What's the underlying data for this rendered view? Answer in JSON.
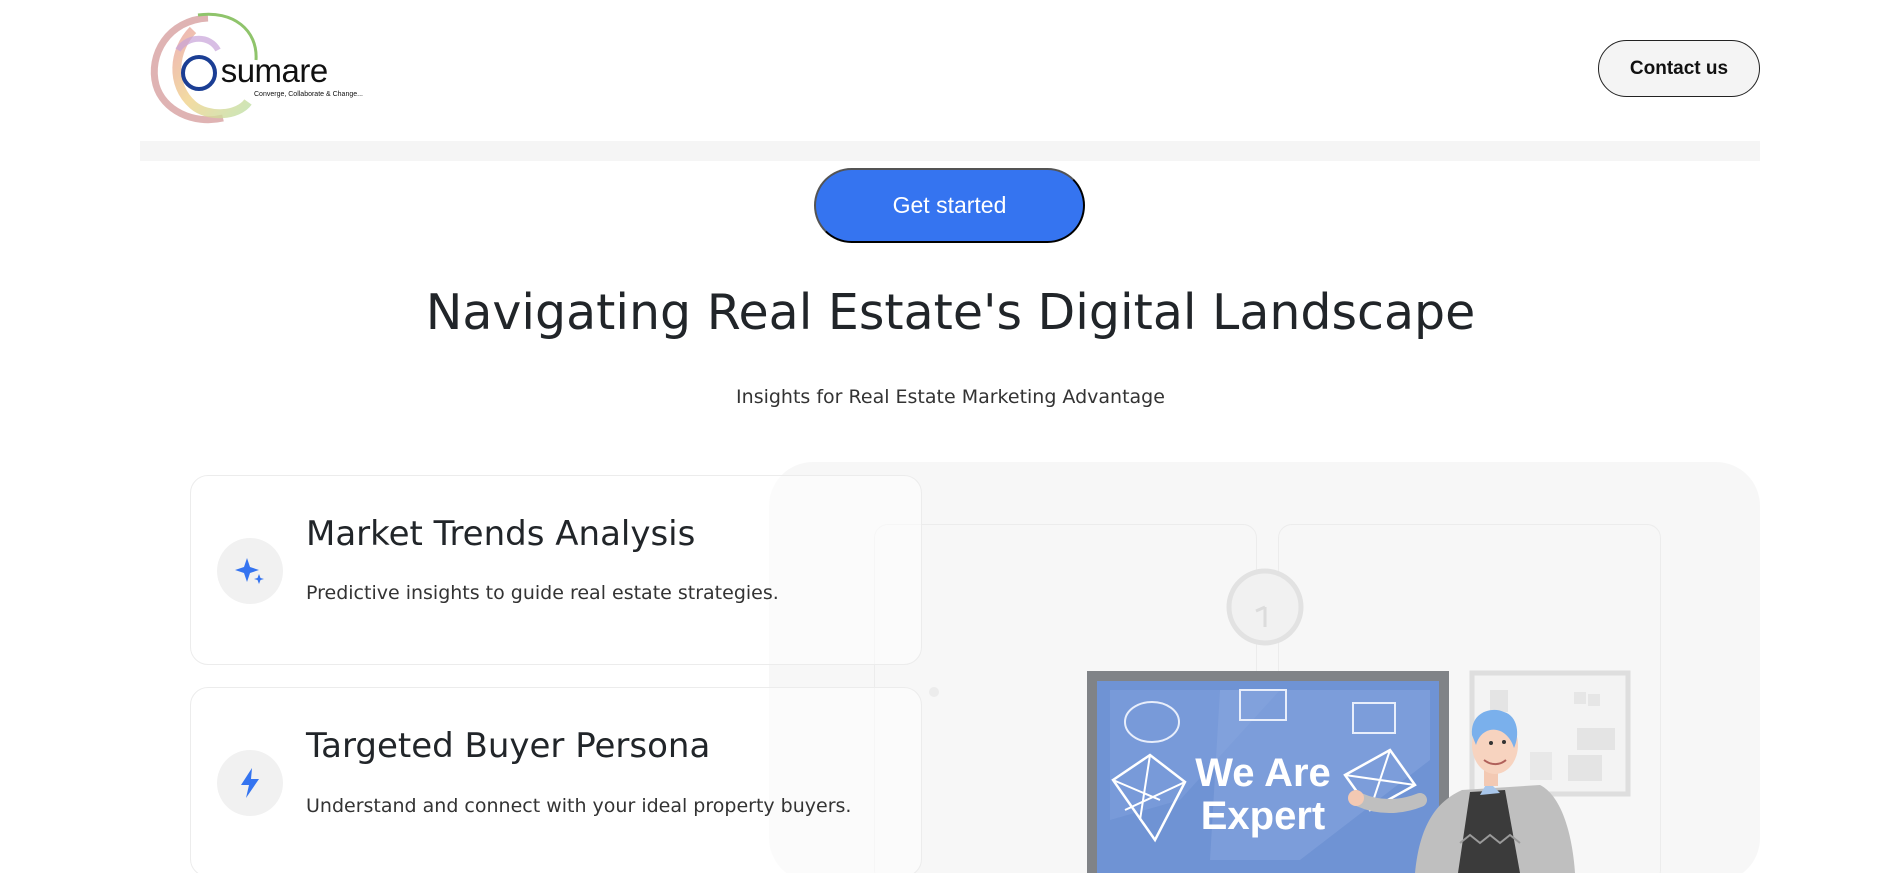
{
  "header": {
    "logo": {
      "name": "sumare",
      "tagline": "Converge, Collaborate & Change..."
    },
    "contact_label": "Contact us"
  },
  "hero": {
    "cta_label": "Get started",
    "title": "Navigating Real Estate's Digital Landscape",
    "subtitle": "Insights for Real Estate Marketing Advantage"
  },
  "features": [
    {
      "icon": "sparkle-icon",
      "title": "Market Trends Analysis",
      "description": "Predictive insights to guide real estate strategies."
    },
    {
      "icon": "lightning-icon",
      "title": "Targeted Buyer Persona",
      "description": "Understand and connect with your ideal property buyers."
    }
  ],
  "illustration": {
    "board_line1": "We Are",
    "board_line2": "Expert"
  },
  "colors": {
    "accent": "#3574f0",
    "board": "#6f93d4",
    "panel": "#f7f7f7"
  }
}
